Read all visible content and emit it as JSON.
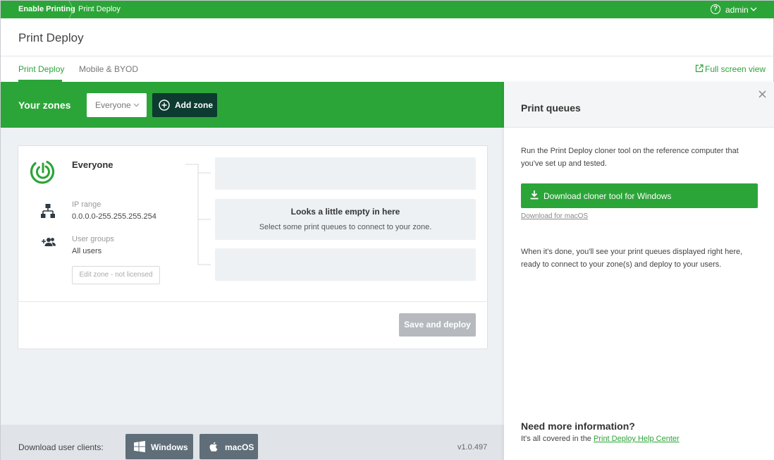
{
  "topbar": {
    "crumb_home": "Enable Printing",
    "crumb_current": "Print Deploy",
    "help_glyph": "?",
    "user": "admin"
  },
  "header": {
    "title": "Print Deploy",
    "tabs": [
      {
        "label": "Print Deploy",
        "active": true
      },
      {
        "label": "Mobile & BYOD",
        "active": false
      }
    ],
    "fullscreen_label": "Full screen view"
  },
  "zones": {
    "title": "Your zones",
    "filter_value": "Everyone",
    "add_label": "Add zone"
  },
  "zone_card": {
    "name": "Everyone",
    "ip_label": "IP range",
    "ip_value": "0.0.0.0-255.255.255.254",
    "groups_label": "User groups",
    "groups_value": "All users",
    "edit_label": "Edit zone - not licensed",
    "empty_title": "Looks a little empty in here",
    "empty_subtitle": "Select some print queues to connect to your zone.",
    "save_label": "Save and deploy"
  },
  "footer": {
    "label": "Download user clients:",
    "windows_label": "Windows",
    "macos_label": "macOS",
    "version": "v1.0.497"
  },
  "panel": {
    "title": "Print queues",
    "intro": "Run the Print Deploy cloner tool on the reference computer that you've set up and tested.",
    "download_windows": "Download cloner tool for Windows",
    "download_mac": "Download for macOS",
    "after_text": "When it's done, you'll see your print queues displayed right here, ready to connect to your zone(s) and deploy to your users.",
    "need_info": "Need more information?",
    "covered_prefix": "It's all covered in the ",
    "help_link": "Print Deploy Help Center"
  },
  "colors": {
    "brand_green": "#2ba538",
    "dark_button": "#0d3b30",
    "client_button": "#5f6e78"
  }
}
